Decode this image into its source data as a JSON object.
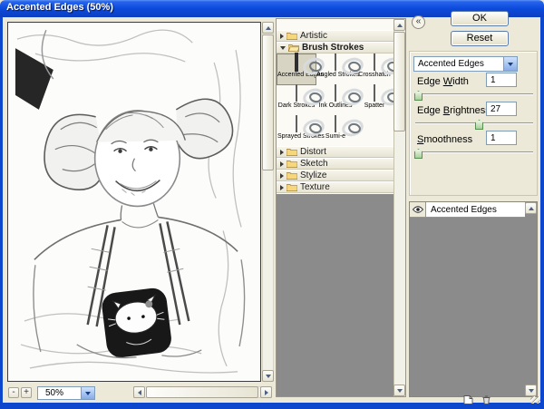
{
  "window": {
    "title": "Accented Edges (50%)"
  },
  "preview": {
    "zoom_out_label": "-",
    "zoom_in_label": "+",
    "zoom_level": "50%"
  },
  "filter_browser": {
    "categories": [
      {
        "label": "Artistic",
        "expanded": false
      },
      {
        "label": "Brush Strokes",
        "expanded": true
      },
      {
        "label": "Distort",
        "expanded": false
      },
      {
        "label": "Sketch",
        "expanded": false
      },
      {
        "label": "Stylize",
        "expanded": false
      },
      {
        "label": "Texture",
        "expanded": false
      }
    ],
    "filters": [
      {
        "label": "Accented Edges",
        "selected": true
      },
      {
        "label": "Angled Strokes",
        "selected": false
      },
      {
        "label": "Crosshatch",
        "selected": false
      },
      {
        "label": "Dark Strokes",
        "selected": false
      },
      {
        "label": "Ink Outlines",
        "selected": false
      },
      {
        "label": "Spatter",
        "selected": false
      },
      {
        "label": "Sprayed Strokes",
        "selected": false
      },
      {
        "label": "Sumi-e",
        "selected": false
      }
    ]
  },
  "panel": {
    "ok_label": "OK",
    "reset_label": "Reset",
    "filter_dropdown_value": "Accented Edges",
    "sliders": [
      {
        "pre": "Edge ",
        "key": "W",
        "post": "idth",
        "value": "1"
      },
      {
        "pre": "Edge ",
        "key": "B",
        "post": "rightness",
        "value": "27"
      },
      {
        "pre": "",
        "key": "S",
        "post": "moothness",
        "value": "1"
      }
    ]
  },
  "effect_layers": {
    "items": [
      {
        "label": "Accented Edges",
        "visible": true
      }
    ]
  }
}
